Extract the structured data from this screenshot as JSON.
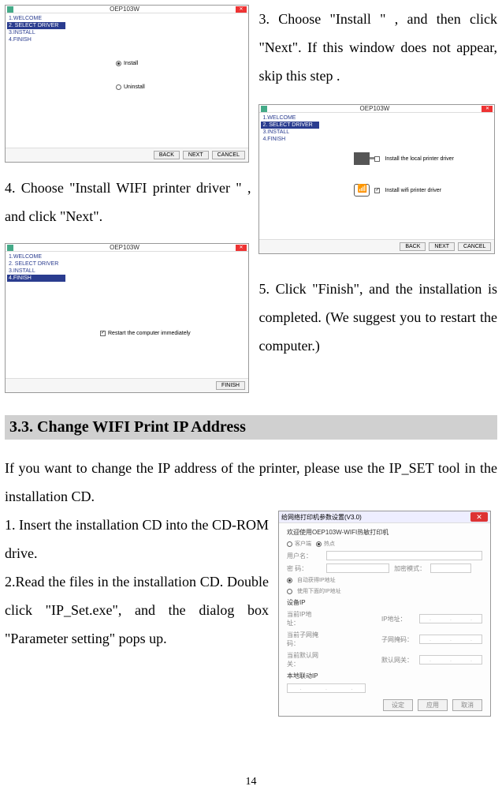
{
  "step3_text": "3. Choose \"Install \" , and then click \"Next\". If this window does not appear, skip this step .",
  "step4_text": "4. Choose \"Install WIFI printer driver \" , and click \"Next\".",
  "step5_text": "5. Click \"Finish\", and the installation is completed. (We suggest you to restart the computer.)",
  "installer": {
    "title": "OEP103W",
    "steps": [
      "1.WELCOME",
      "2. SELECT DRIVER",
      "3.INSTALL",
      "4.FINISH"
    ],
    "radio_install": "Install",
    "radio_uninstall": "Uninstall",
    "check_restart": "Restart the computer immediately",
    "drv_local": "Install the local printer driver",
    "drv_wifi": "Install wifi printer driver",
    "btn_back": "BACK",
    "btn_next": "NEXT",
    "btn_cancel": "CANCEL",
    "btn_finish": "FINISH"
  },
  "section33_heading": "3.3.   Change WIFI Print IP Address",
  "section33_intro": "If you want to change the IP address of the printer, please use the IP_SET tool in the installation CD.",
  "section33_step1": "1. Insert the installation CD into the CD-ROM drive.",
  "section33_step2": "2.Read the files in the installation CD. Double click \"IP_Set.exe\", and the dialog box \"Parameter setting\" pops up.",
  "ipdialog": {
    "title": "给网络打印机参数设置(V3.0)",
    "welcome": "欢迎使用OEP103W-WIFI热敏打印机",
    "r_client": "客户端",
    "r_ap": "热点",
    "lbl_user": "用户名：",
    "lbl_pwd": "密 码：",
    "lbl_encrypt": "加密模式：",
    "r_auto_ip": "自动获得IP地址",
    "r_manual_ip": "使用下面的IP地址",
    "lbl_setip": "设备IP",
    "lbl_cur_ip": "当前IP地址：",
    "lbl_cur_mask": "当前子网掩码：",
    "lbl_cur_gw": "当前默认网关：",
    "lbl_ip": "IP地址：",
    "lbl_mask": "子网掩码：",
    "lbl_gw": "默认网关：",
    "lbl_local": "本地联动IP",
    "btn_set": "设定",
    "btn_apply": "应用",
    "btn_cancel": "取消"
  },
  "page_number": "14"
}
